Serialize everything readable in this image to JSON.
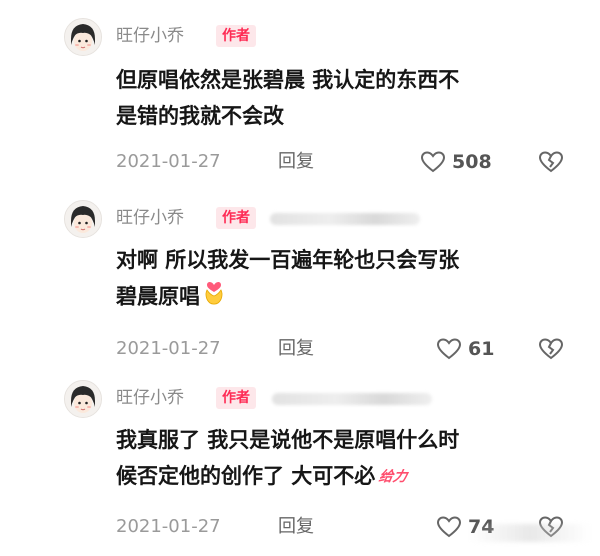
{
  "comments": [
    {
      "author": "旺仔小乔",
      "badge": "作者",
      "lines": [
        "但原唱依然是张碧晨 我认定的东西不",
        "是错的我就不会改"
      ],
      "date": "2021-01-27",
      "reply": "回复",
      "likes": "508",
      "has_blurred_name": false,
      "trailing": ""
    },
    {
      "author": "旺仔小乔",
      "badge": "作者",
      "lines": [
        "对啊 所以我发一百遍年轮也只会写张",
        "碧晨原唱"
      ],
      "date": "2021-01-27",
      "reply": "回复",
      "likes": "61",
      "has_blurred_name": true,
      "trailing": "heart-hands-emoji"
    },
    {
      "author": "旺仔小乔",
      "badge": "作者",
      "lines": [
        "我真服了 我只是说他不是原唱什么时",
        "候否定他的创作了 大可不必"
      ],
      "date": "2021-01-27",
      "reply": "回复",
      "likes": "74",
      "has_blurred_name": true,
      "trailing_text": "给力"
    }
  ],
  "colors": {
    "badge_bg": "#fde7ea",
    "badge_text": "#fe2c55",
    "meta_text": "#9a9a9a"
  },
  "icons": {
    "like": "heart-outline-icon",
    "dislike": "broken-heart-icon"
  }
}
